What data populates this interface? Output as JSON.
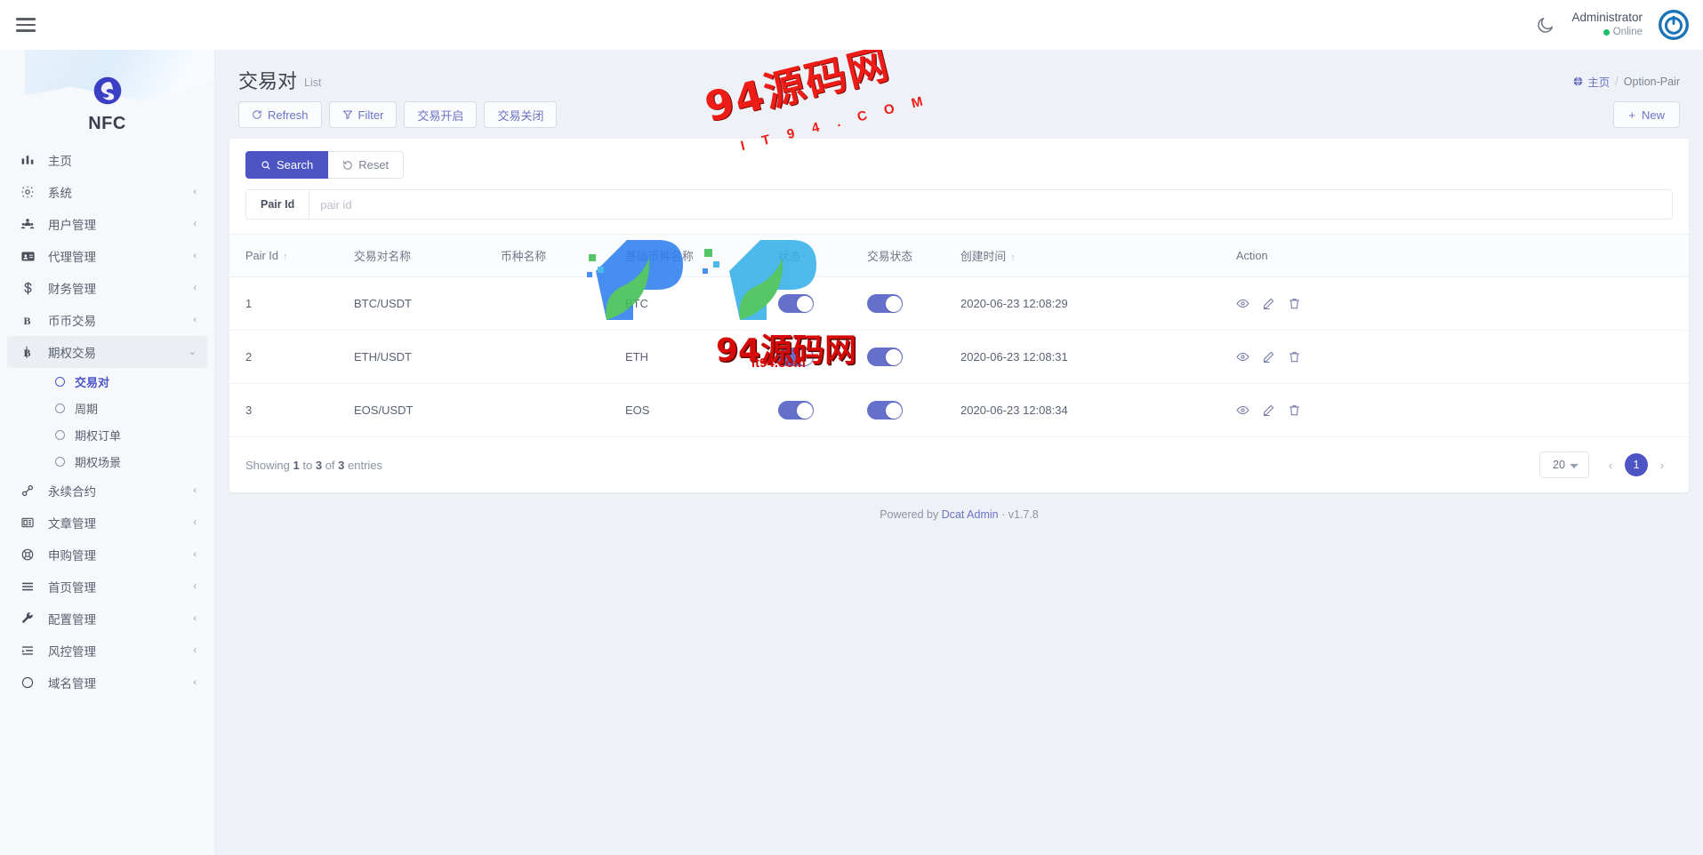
{
  "topbar": {
    "menu_toggle": "hamburger-menu",
    "theme_toggle_icon": "moon-icon",
    "user_name": "Administrator",
    "user_status": "Online",
    "avatar_icon": "user-avatar"
  },
  "sidebar": {
    "brand": "NFC",
    "items": [
      {
        "label": "主页",
        "icon": "chart-bar-icon",
        "arrow": ""
      },
      {
        "label": "系统",
        "icon": "gear-icon",
        "arrow": "‹"
      },
      {
        "label": "用户管理",
        "icon": "users-icon",
        "arrow": "‹"
      },
      {
        "label": "代理管理",
        "icon": "id-card-icon",
        "arrow": "‹"
      },
      {
        "label": "财务管理",
        "icon": "dollar-icon",
        "arrow": "‹"
      },
      {
        "label": "币币交易",
        "icon": "letter-b-icon",
        "arrow": "‹"
      },
      {
        "label": "期权交易",
        "icon": "bitcoin-icon",
        "arrow": "⌄",
        "open": true
      },
      {
        "label": "永续合约",
        "icon": "link-icon",
        "arrow": "‹"
      },
      {
        "label": "文章管理",
        "icon": "article-icon",
        "arrow": "‹"
      },
      {
        "label": "申购管理",
        "icon": "lifebuoy-icon",
        "arrow": "‹"
      },
      {
        "label": "首页管理",
        "icon": "list-icon",
        "arrow": "‹"
      },
      {
        "label": "配置管理",
        "icon": "wrench-icon",
        "arrow": "‹"
      },
      {
        "label": "风控管理",
        "icon": "indent-list-icon",
        "arrow": "‹"
      },
      {
        "label": "域名管理",
        "icon": "circle-icon",
        "arrow": "‹"
      }
    ],
    "submenu": [
      {
        "label": "交易对",
        "active": true
      },
      {
        "label": "周期",
        "active": false
      },
      {
        "label": "期权订单",
        "active": false
      },
      {
        "label": "期权场景",
        "active": false
      }
    ]
  },
  "page": {
    "title": "交易对",
    "subtitle": "List",
    "breadcrumb_home": "主页",
    "breadcrumb_sep": "/",
    "breadcrumb_current": "Option-Pair"
  },
  "toolbar": {
    "refresh_label": "Refresh",
    "filter_label": "Filter",
    "trade_open_label": "交易开启",
    "trade_close_label": "交易关闭",
    "new_label": "New",
    "new_plus": "+"
  },
  "filter": {
    "search_label": "Search",
    "reset_label": "Reset",
    "pair_id_label": "Pair Id",
    "pair_id_value": "",
    "pair_id_placeholder": "pair id"
  },
  "table": {
    "columns": [
      {
        "label": "Pair Id",
        "sort": "↑"
      },
      {
        "label": "交易对名称",
        "sort": ""
      },
      {
        "label": "币种名称",
        "sort": ""
      },
      {
        "label": "基础币种名称",
        "sort": ""
      },
      {
        "label": "状态",
        "sort": ""
      },
      {
        "label": "交易状态",
        "sort": ""
      },
      {
        "label": "创建时间",
        "sort": "↑"
      },
      {
        "label": "Action",
        "sort": ""
      }
    ],
    "rows": [
      {
        "pair_id": "1",
        "pair_name": "BTC/USDT",
        "coin_name": "",
        "base_coin": "BTC",
        "status_on": true,
        "trade_status_on": true,
        "created_at": "2020-06-23 12:08:29"
      },
      {
        "pair_id": "2",
        "pair_name": "ETH/USDT",
        "coin_name": "",
        "base_coin": "ETH",
        "status_on": true,
        "trade_status_on": true,
        "created_at": "2020-06-23 12:08:31"
      },
      {
        "pair_id": "3",
        "pair_name": "EOS/USDT",
        "coin_name": "",
        "base_coin": "EOS",
        "status_on": true,
        "trade_status_on": true,
        "created_at": "2020-06-23 12:08:34"
      }
    ],
    "action_icons": [
      "eye-icon",
      "pencil-icon",
      "trash-icon"
    ]
  },
  "footer_bar": {
    "entries_prefix": "Showing",
    "entries_from": "1",
    "entries_to_word": "to",
    "entries_to": "3",
    "entries_of_word": "of",
    "entries_total": "3",
    "entries_suffix": "entries",
    "per_page": "20",
    "prev": "‹",
    "page_current": "1",
    "next": "›"
  },
  "footer": {
    "powered_prefix": "Powered by",
    "powered_link": "Dcat Admin",
    "powered_dot": "·",
    "version": "v1.7.8"
  },
  "watermark": {
    "line1": "94源码网",
    "line2": "I T 9 4 . C O M",
    "line3": "94源码网",
    "line4": "it94.com"
  },
  "colors": {
    "accent": "#4c55c3",
    "page_bg": "#eef1f6",
    "sidebar_bg": "#f7f8fb",
    "online": "#1bbf69",
    "watermark_red": "#ee1c16"
  }
}
